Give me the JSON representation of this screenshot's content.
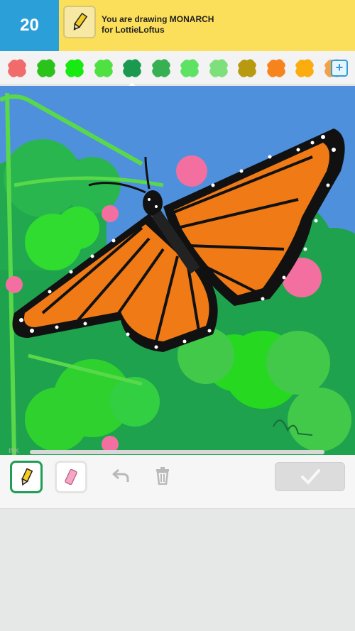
{
  "header": {
    "counter": "20",
    "prompt_line1": "You are drawing MONARCH",
    "prompt_line2": "for LottieLoftus"
  },
  "palette": {
    "colors": [
      "#f16b6b",
      "#2bc31b",
      "#16ea10",
      "#4fe042",
      "#1b9a4f",
      "#36b051",
      "#5ee263",
      "#7de07a",
      "#b79a0f",
      "#f7831c",
      "#fbad10",
      "#f0a24a"
    ],
    "selected_index": 5,
    "add_label": "+"
  },
  "canvas": {
    "watermark": "INK"
  },
  "toolbar": {
    "active_tool": "pencil"
  }
}
